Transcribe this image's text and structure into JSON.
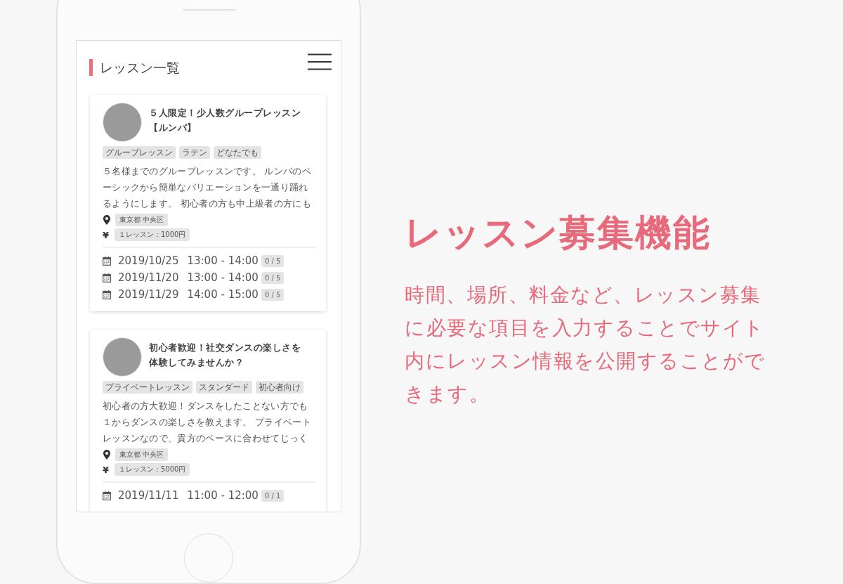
{
  "screen": {
    "title": "レッスン一覧",
    "lessons": [
      {
        "title": "５人限定！少人数グループレッスン【ルンバ】",
        "tags": [
          "グループレッスン",
          "ラテン",
          "どなたでも"
        ],
        "description": [
          "５名様までのグループレッスンです。 ルンバのベ",
          "ーシックから簡単なバリエーションを一通り踊れ",
          "るようにします。 初心者の方も中上級者の方にも"
        ],
        "location": "東京都 中央区",
        "currency": "¥",
        "price": "１レッスン：1000円",
        "schedules": [
          {
            "date": "2019/10/25",
            "time": "13:00 - 14:00",
            "capacity": "0 / 5"
          },
          {
            "date": "2019/11/20",
            "time": "13:00 - 14:00",
            "capacity": "0 / 5"
          },
          {
            "date": "2019/11/29",
            "time": "14:00 - 15:00",
            "capacity": "0 / 5"
          }
        ]
      },
      {
        "title": "初心者歓迎！社交ダンスの楽しさを体験してみませんか？",
        "tags": [
          "プライベートレッスン",
          "スタンダード",
          "初心者向け"
        ],
        "description": [
          "初心者の方大歓迎！ダンスをしたことない方でも",
          "１からダンスの楽しさを教えます。 プライベート",
          "レッスンなので、貴方のペースに合わせてじっく"
        ],
        "location": "東京都 中央区",
        "currency": "¥",
        "price": "１レッスン：5000円",
        "schedules": [
          {
            "date": "2019/11/11",
            "time": "11:00 - 12:00",
            "capacity": "0 / 1"
          }
        ]
      }
    ]
  },
  "feature": {
    "heading": "レッスン募集機能",
    "description": [
      "時間、場所、料金など、レッスン募集",
      "に必要な項目を入力することでサイト",
      "内にレッスン情報を公開することがで",
      "きます。"
    ]
  }
}
